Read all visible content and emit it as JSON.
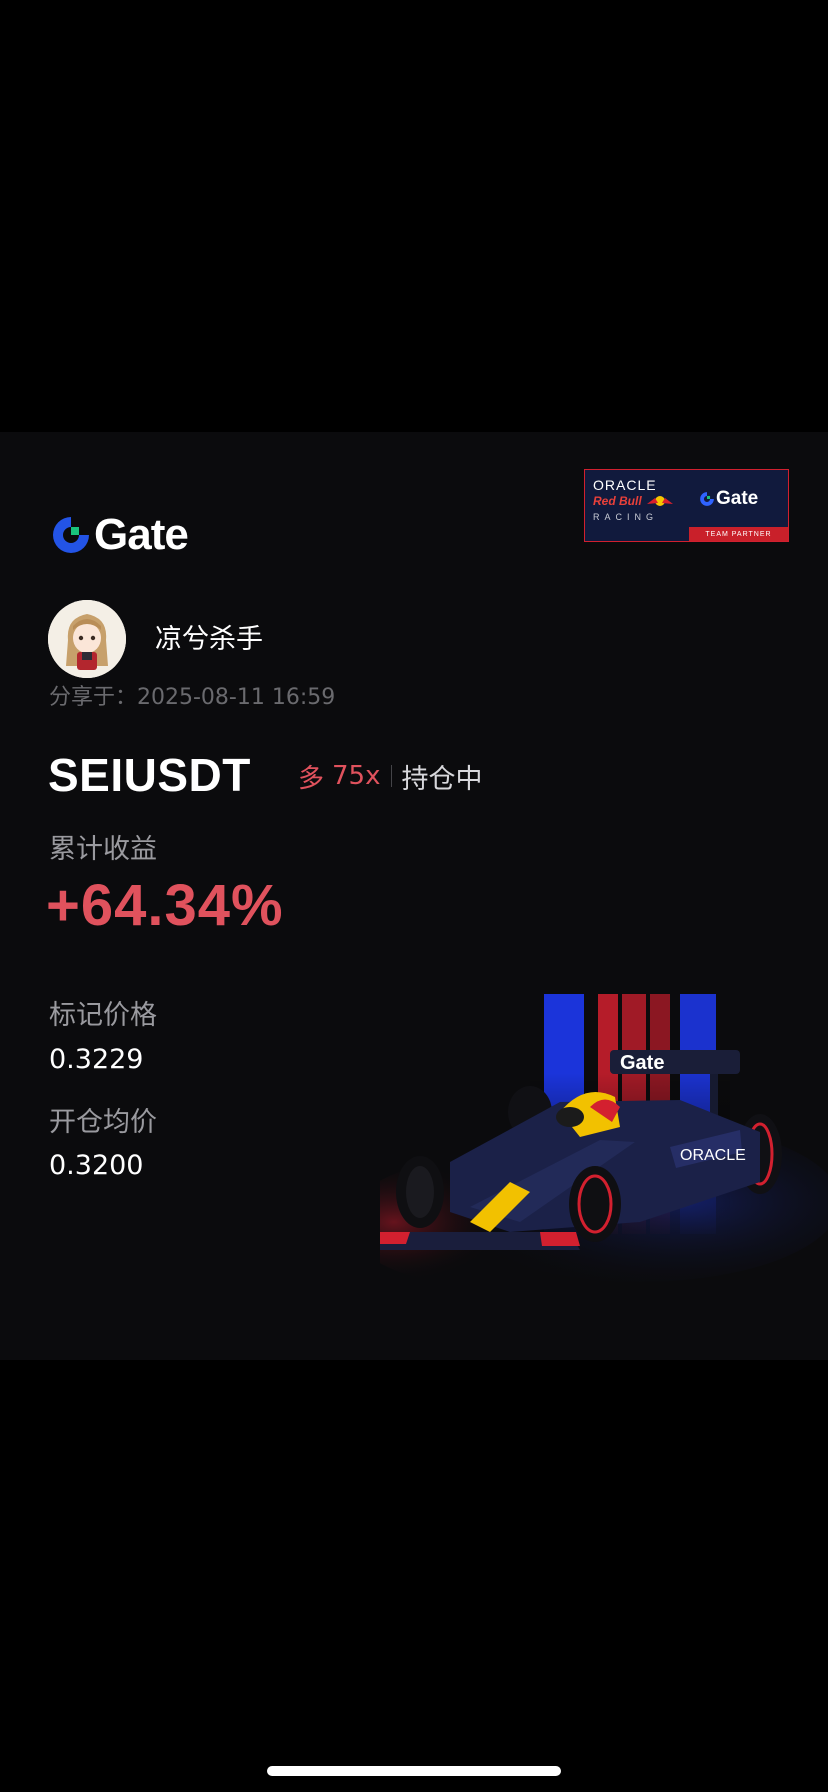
{
  "brand": {
    "logo_text": "Gate",
    "accent_color": "#2354e6",
    "logo_green": "#19c37d"
  },
  "partner_badge": {
    "oracle": "ORACLE",
    "redbull": "Red Bull",
    "racing": "RACING",
    "gate": "Gate",
    "footer": "TEAM PARTNER"
  },
  "user": {
    "name": "凉兮杀手",
    "share_time": "分享于：2025-08-11 16:59"
  },
  "position": {
    "pair": "SEIUSDT",
    "side": "多",
    "leverage": "75x",
    "status": "持仓中"
  },
  "pnl": {
    "label": "累计收益",
    "value": "+64.34%",
    "color": "#e0525d"
  },
  "prices": {
    "mark_label": "标记价格",
    "mark_value": "0.3229",
    "entry_label": "开仓均价",
    "entry_value": "0.3200"
  },
  "icons": [
    "gate-logo-icon",
    "red-bull-icon",
    "avatar-image",
    "f1-car-image"
  ]
}
